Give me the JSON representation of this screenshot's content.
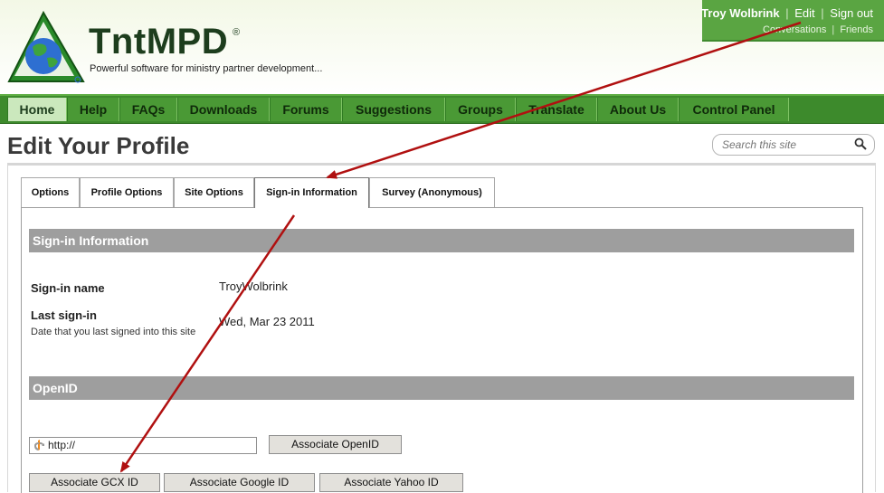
{
  "brand": {
    "name": "TntMPD",
    "reg": "®",
    "tagline": "Powerful software for ministry partner development..."
  },
  "user": {
    "name": "Troy Wolbrink",
    "edit": "Edit",
    "signout": "Sign out",
    "conversations": "Conversations",
    "friends": "Friends",
    "separator": "|"
  },
  "nav": [
    {
      "label": "Home"
    },
    {
      "label": "Help"
    },
    {
      "label": "FAQs"
    },
    {
      "label": "Downloads"
    },
    {
      "label": "Forums"
    },
    {
      "label": "Suggestions"
    },
    {
      "label": "Groups"
    },
    {
      "label": "Translate"
    },
    {
      "label": "About Us"
    },
    {
      "label": "Control Panel"
    }
  ],
  "page": {
    "title": "Edit Your Profile"
  },
  "search": {
    "placeholder": "Search this site"
  },
  "tabs": [
    {
      "label": "Options"
    },
    {
      "label": "Profile Options"
    },
    {
      "label": "Site Options"
    },
    {
      "label": "Sign-in Information"
    },
    {
      "label": "Survey (Anonymous)"
    }
  ],
  "signin": {
    "header": "Sign-in Information",
    "name_label": "Sign-in name",
    "name_value": "TroyWolbrink",
    "last_label": "Last sign-in",
    "last_desc": "Date that you last signed into this site",
    "last_value": "Wed, Mar 23 2011"
  },
  "openid": {
    "header": "OpenID",
    "field_value": "http://",
    "associate_openid": "Associate OpenID",
    "associate_gcx": "Associate GCX ID",
    "associate_google": "Associate Google ID",
    "associate_yahoo": "Associate Yahoo ID"
  },
  "colors": {
    "nav_green": "#4a9935",
    "nav_active": "#cbe8bd",
    "user_box": "#5aa542",
    "section_bar": "#9e9e9e",
    "annotation_arrow": "#b01010"
  }
}
